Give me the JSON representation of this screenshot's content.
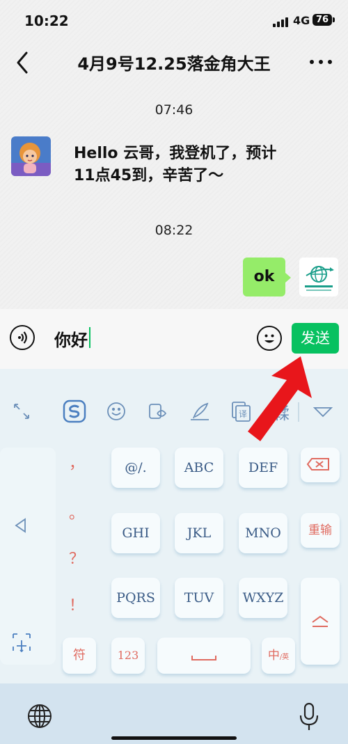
{
  "status": {
    "time": "10:22",
    "network": "4G",
    "battery": "76"
  },
  "nav": {
    "title": "4月9号12.25落金角大王"
  },
  "messages": [
    {
      "time": "07:46",
      "side": "left",
      "text": "Hello 云哥，我登机了，预计11点45到，辛苦了～"
    },
    {
      "time": "08:22",
      "side": "right",
      "text": "ok"
    }
  ],
  "input": {
    "text": "你好",
    "send_label": "发送"
  },
  "keyboard": {
    "row1": [
      "@/.",
      "ABC",
      "DEF"
    ],
    "row2": [
      "GHI",
      "JKL",
      "MNO"
    ],
    "row3": [
      "PQRS",
      "TUV",
      "WXYZ"
    ],
    "redo_label": "重输",
    "symbol_label": "符",
    "num_label": "123",
    "lang_label": "中",
    "lang_sub": "/英",
    "candidate_char": "鞣",
    "punctuation": [
      "，",
      "。",
      "？",
      "！"
    ]
  },
  "colors": {
    "accent": "#07c160",
    "bubble": "#95ec69",
    "key_text": "#3a5b86",
    "key_red": "#e06a5f"
  },
  "icons": {
    "status": [
      "signal-icon",
      "battery-icon"
    ],
    "nav": [
      "back-arrow-icon",
      "more-dots-icon"
    ],
    "input": [
      "voice-icon",
      "emoji-icon"
    ],
    "toolbar": [
      "collapse-icon",
      "sogou-logo-icon",
      "emoji-face-icon",
      "clipboard-icon",
      "handwriting-icon",
      "translate-icon",
      "dropdown-triangle-icon"
    ],
    "keyboard": [
      "backspace-icon",
      "cursor-left-icon",
      "enter-icon",
      "space-icon",
      "move-icon"
    ],
    "bottom": [
      "globe-icon",
      "microphone-icon"
    ]
  }
}
